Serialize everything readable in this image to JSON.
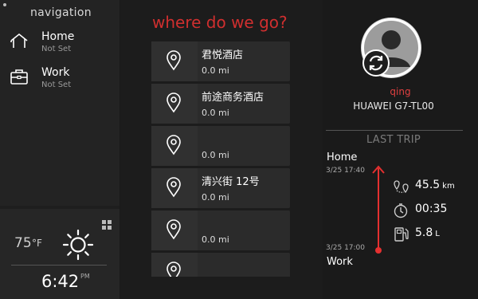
{
  "navigation": {
    "title": "navigation",
    "items": [
      {
        "label": "Home",
        "sub": "Not Set",
        "icon": "home-icon"
      },
      {
        "label": "Work",
        "sub": "Not Set",
        "icon": "briefcase-icon"
      }
    ]
  },
  "weather": {
    "temperature": "75",
    "unit": "°F",
    "condition_icon": "sun-icon",
    "time": "6:42",
    "ampm": "PM"
  },
  "destinations": {
    "title": "where do we go?",
    "items": [
      {
        "name": "君悦酒店",
        "distance": "0.0 mi"
      },
      {
        "name": "前途商务酒店",
        "distance": "0.0 mi"
      },
      {
        "name": "",
        "distance": "0.0 mi"
      },
      {
        "name": "清兴街 12号",
        "distance": "0.0 mi"
      },
      {
        "name": "",
        "distance": "0.0 mi"
      },
      {
        "name": "",
        "distance": ""
      }
    ]
  },
  "profile": {
    "username": "qing",
    "device": "HUAWEI G7-TL00"
  },
  "last_trip": {
    "title": "LAST TRIP",
    "from": {
      "label": "Home",
      "time": "3/25 17:40"
    },
    "to": {
      "label": "Work",
      "time": "3/25 17:00"
    },
    "distance": {
      "value": "45.5",
      "unit": "km"
    },
    "duration": {
      "value": "00:35"
    },
    "fuel": {
      "value": "5.8",
      "unit": "L"
    }
  },
  "colors": {
    "accent": "#d02f2f",
    "background": "#1a1a1a",
    "card": "#2b2b2b"
  }
}
